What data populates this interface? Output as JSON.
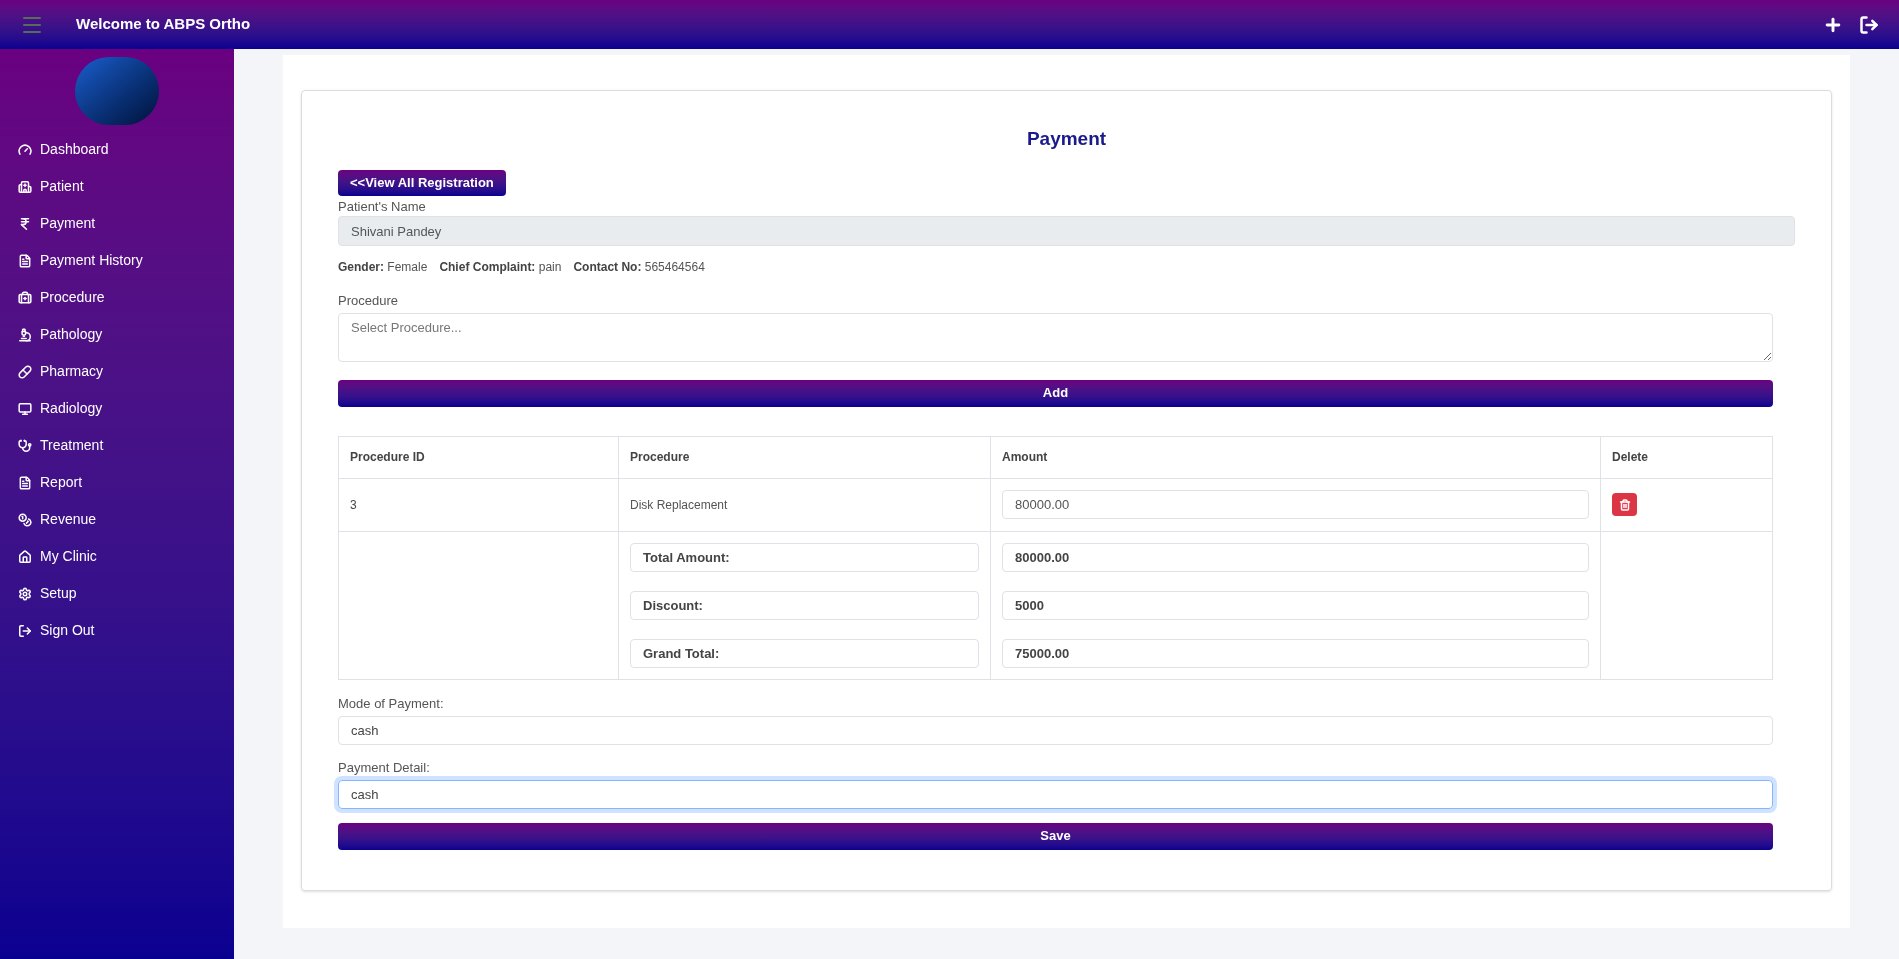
{
  "header": {
    "title": "Welcome to ABPS Ortho"
  },
  "sidebar": {
    "items": [
      {
        "label": "Dashboard"
      },
      {
        "label": "Patient"
      },
      {
        "label": "Payment"
      },
      {
        "label": "Payment History"
      },
      {
        "label": "Procedure"
      },
      {
        "label": "Pathology"
      },
      {
        "label": "Pharmacy"
      },
      {
        "label": "Radiology"
      },
      {
        "label": "Treatment"
      },
      {
        "label": "Report"
      },
      {
        "label": "Revenue"
      },
      {
        "label": "My Clinic"
      },
      {
        "label": "Setup"
      },
      {
        "label": "Sign Out"
      }
    ]
  },
  "form": {
    "title": "Payment",
    "back_button": "<<View All Registration",
    "patient_name": {
      "label": "Patient's Name",
      "value": "Shivani Pandey"
    },
    "info": [
      {
        "label": "Gender:",
        "value": "Female"
      },
      {
        "label": "Chief Complaint:",
        "value": "pain"
      },
      {
        "label": "Contact No:",
        "value": "565464564"
      }
    ],
    "procedure": {
      "label": "Procedure",
      "placeholder": "Select Procedure..."
    },
    "add_button": "Add",
    "table": {
      "columns": [
        "Procedure ID",
        "Procedure",
        "Amount",
        "Delete"
      ],
      "rows": [
        {
          "id": "3",
          "procedure": "Disk Replacement",
          "amount": "80000.00"
        }
      ],
      "totals": [
        {
          "label": "Total Amount:",
          "value": "80000.00"
        },
        {
          "label": "Discount:",
          "value": "5000"
        },
        {
          "label": "Grand Total:",
          "value": "75000.00"
        }
      ]
    },
    "mode_of_payment": {
      "label": "Mode of Payment:",
      "value": "cash"
    },
    "payment_detail": {
      "label": "Payment Detail:",
      "value": "cash",
      "focused": true
    },
    "save_button": "Save"
  }
}
